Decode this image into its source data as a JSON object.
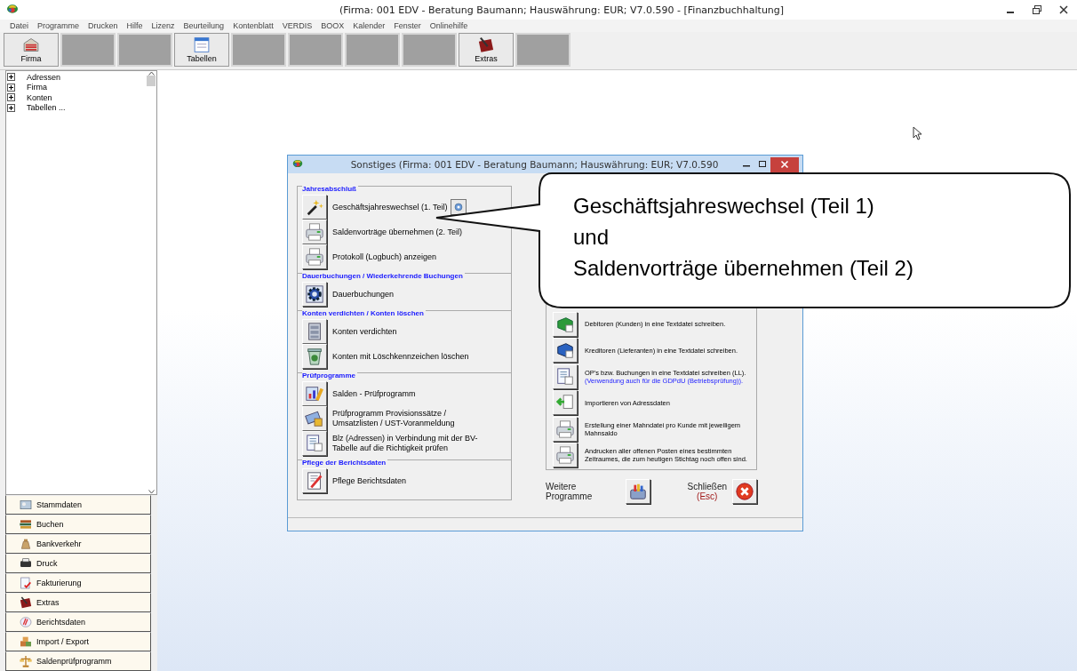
{
  "window": {
    "title": "(Firma: 001 EDV - Beratung Baumann;  Hauswährung: EUR; V7.0.590 - [Finanzbuchhaltung]"
  },
  "menu": [
    "Datei",
    "Programme",
    "Drucken",
    "Hilfe",
    "Lizenz",
    "Beurteilung",
    "Kontenblatt",
    "VERDIS",
    "BOOX",
    "Kalender",
    "Fenster",
    "Onlinehilfe"
  ],
  "toolbar": [
    {
      "kind": "firma",
      "label": "Firma"
    },
    {
      "kind": "blank"
    },
    {
      "kind": "blank"
    },
    {
      "kind": "table",
      "label": "Tabellen"
    },
    {
      "kind": "blank"
    },
    {
      "kind": "blank"
    },
    {
      "kind": "blank"
    },
    {
      "kind": "blank"
    },
    {
      "kind": "extras",
      "label": "Extras"
    },
    {
      "kind": "blank"
    }
  ],
  "tree": [
    {
      "label": "Adressen",
      "expanded": false
    },
    {
      "label": "Firma",
      "expanded": false
    },
    {
      "label": "Konten",
      "expanded": false
    },
    {
      "label": "Tabellen ...",
      "expanded": false
    }
  ],
  "nav": [
    {
      "kind": "card",
      "label": "Stammdaten"
    },
    {
      "kind": "books",
      "label": "Buchen"
    },
    {
      "kind": "bag",
      "label": "Bankverkehr"
    },
    {
      "kind": "printer",
      "label": "Druck"
    },
    {
      "kind": "invoice",
      "label": "Fakturierung"
    },
    {
      "kind": "extras",
      "label": "Extras"
    },
    {
      "kind": "report",
      "label": "Berichtsdaten"
    },
    {
      "kind": "boxes",
      "label": "Import / Export"
    },
    {
      "kind": "scale",
      "label": "Saldenprüfprogramm"
    }
  ],
  "dialog": {
    "title": "Sonstiges   (Firma: 001 EDV - Beratung Baumann;  Hauswährung: EUR; V7.0.590",
    "groups": [
      {
        "title": "Jahresabschluß",
        "items": [
          {
            "kind": "wand",
            "label": "Geschäftsjahreswechsel (1. Teil)",
            "help": true
          },
          {
            "kind": "printer",
            "label": "Saldenvorträge übernehmen (2. Teil)",
            "help": false
          },
          {
            "kind": "printer",
            "label": "Protokoll (Logbuch) anzeigen",
            "help": false
          }
        ]
      },
      {
        "title": "Dauerbuchungen / Wiederkehrende Buchungen",
        "items": [
          {
            "kind": "gear",
            "label": "Dauerbuchungen",
            "help": false
          }
        ]
      },
      {
        "title": "Konten verdichten / Konten löschen",
        "items": [
          {
            "kind": "cabinet",
            "label": "Konten verdichten",
            "help": false
          },
          {
            "kind": "bin",
            "label": "Konten mit Löschkennzeichen löschen",
            "help": false
          }
        ]
      },
      {
        "title": "Prüfprogramme",
        "items": [
          {
            "kind": "chart",
            "label": "Salden - Prüfprogramm",
            "help": false
          },
          {
            "kind": "money",
            "label": "Prüfprogramm Provisionssätze / Umsatzlisten / UST-Voranmeldung",
            "help": false
          },
          {
            "kind": "sheet",
            "label": "Blz (Adressen) in Verbindung mit der BV-Tabelle auf die Richtigkeit prüfen",
            "help": false
          }
        ]
      },
      {
        "title": "Pflege der Berichtsdaten",
        "items": [
          {
            "kind": "pen",
            "label": "Pflege Berichtsdaten",
            "help": false
          }
        ]
      }
    ],
    "export_items": [
      {
        "kind": "green",
        "label": "Debitoren (Kunden) in eine Textdatei schreiben."
      },
      {
        "kind": "blue",
        "label": "Kreditoren (Lieferanten) in eine Textdatei schreiben."
      },
      {
        "kind": "sheet",
        "label": "OP's bzw. Buchungen in eine Textdatei schreiben (LL).",
        "note": "(Verwendung auch für die GDPdU (Betriebsprüfung))."
      },
      {
        "kind": "import",
        "label": "Importieren von Adressdaten"
      },
      {
        "kind": "printer",
        "label": "Erstellung einer Mahndatei pro Kunde mit jeweiligem Mahnsaldo"
      },
      {
        "kind": "printer",
        "label": "Andrucken aller offenen Posten eines bestimmten Zeitraumes, die zum heutigen Stichtag noch offen sind."
      }
    ],
    "more_label": "Weitere Programme",
    "close_label": "Schließen",
    "close_key": "(Esc)"
  },
  "callout": [
    "Geschäftsjahreswechsel (Teil 1)",
    "und",
    "Saldenvorträge übernehmen (Teil 2)"
  ]
}
